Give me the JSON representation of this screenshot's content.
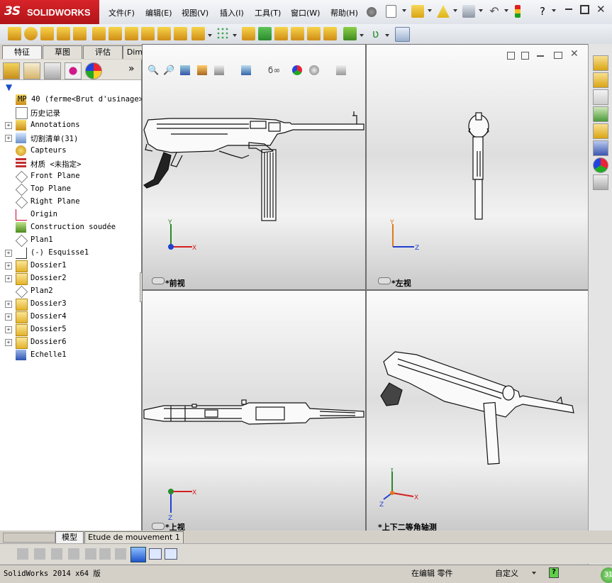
{
  "app": {
    "brand_prefix": "3S",
    "brand": "SOLIDWORKS"
  },
  "menu": [
    "文件(F)",
    "编辑(E)",
    "视图(V)",
    "插入(I)",
    "工具(T)",
    "窗口(W)",
    "帮助(H)"
  ],
  "tabs": [
    "特征",
    "草图",
    "评估",
    "DimXpert"
  ],
  "tree": [
    {
      "label": "MP 40  (ferme<Brut d'usinage>",
      "icon": "part-icon",
      "expand": ""
    },
    {
      "label": "历史记录",
      "icon": "history-icon",
      "expand": ""
    },
    {
      "label": "Annotations",
      "icon": "annotations-icon",
      "expand": "+"
    },
    {
      "label": "切割清单(31)",
      "icon": "cutlist-icon",
      "expand": "+"
    },
    {
      "label": "Capteurs",
      "icon": "sensor-icon",
      "expand": ""
    },
    {
      "label": "材质 <未指定>",
      "icon": "material-icon",
      "expand": ""
    },
    {
      "label": "Front Plane",
      "icon": "plane-icon",
      "expand": ""
    },
    {
      "label": "Top Plane",
      "icon": "plane-icon",
      "expand": ""
    },
    {
      "label": "Right Plane",
      "icon": "plane-icon",
      "expand": ""
    },
    {
      "label": "Origin",
      "icon": "origin-icon",
      "expand": ""
    },
    {
      "label": "Construction soudée",
      "icon": "weldment-icon",
      "expand": ""
    },
    {
      "label": "Plan1",
      "icon": "plane-icon",
      "expand": ""
    },
    {
      "label": "(-) Esquisse1",
      "icon": "sketch-icon",
      "expand": "+"
    },
    {
      "label": "Dossier1",
      "icon": "folder-icon",
      "expand": "+"
    },
    {
      "label": "Dossier2",
      "icon": "folder-icon",
      "expand": "+"
    },
    {
      "label": "Plan2",
      "icon": "plane-icon",
      "expand": ""
    },
    {
      "label": "Dossier3",
      "icon": "folder-icon",
      "expand": "+"
    },
    {
      "label": "Dossier4",
      "icon": "folder-icon",
      "expand": "+"
    },
    {
      "label": "Dossier5",
      "icon": "folder-icon",
      "expand": "+"
    },
    {
      "label": "Dossier6",
      "icon": "folder-icon",
      "expand": "+"
    },
    {
      "label": "Echelle1",
      "icon": "scale-icon",
      "expand": ""
    }
  ],
  "viewports": {
    "front": "*前视",
    "left": "*左视",
    "top": "*上视",
    "iso": "*上下二等角轴测"
  },
  "axes": {
    "x": "X",
    "y": "Y",
    "z": "Z"
  },
  "bottom_tabs": [
    "模型",
    "Etude de mouvement 1"
  ],
  "status": {
    "app_version": "SolidWorks 2014 x64 版",
    "editing": "在编辑 零件",
    "custom": "自定义",
    "help": "?"
  },
  "colors": {
    "brand_red": "#c81d22",
    "axis_x": "#d42020",
    "axis_y": "#2a8a2a",
    "axis_z": "#2040d0",
    "axis_orange": "#e07a1a"
  }
}
